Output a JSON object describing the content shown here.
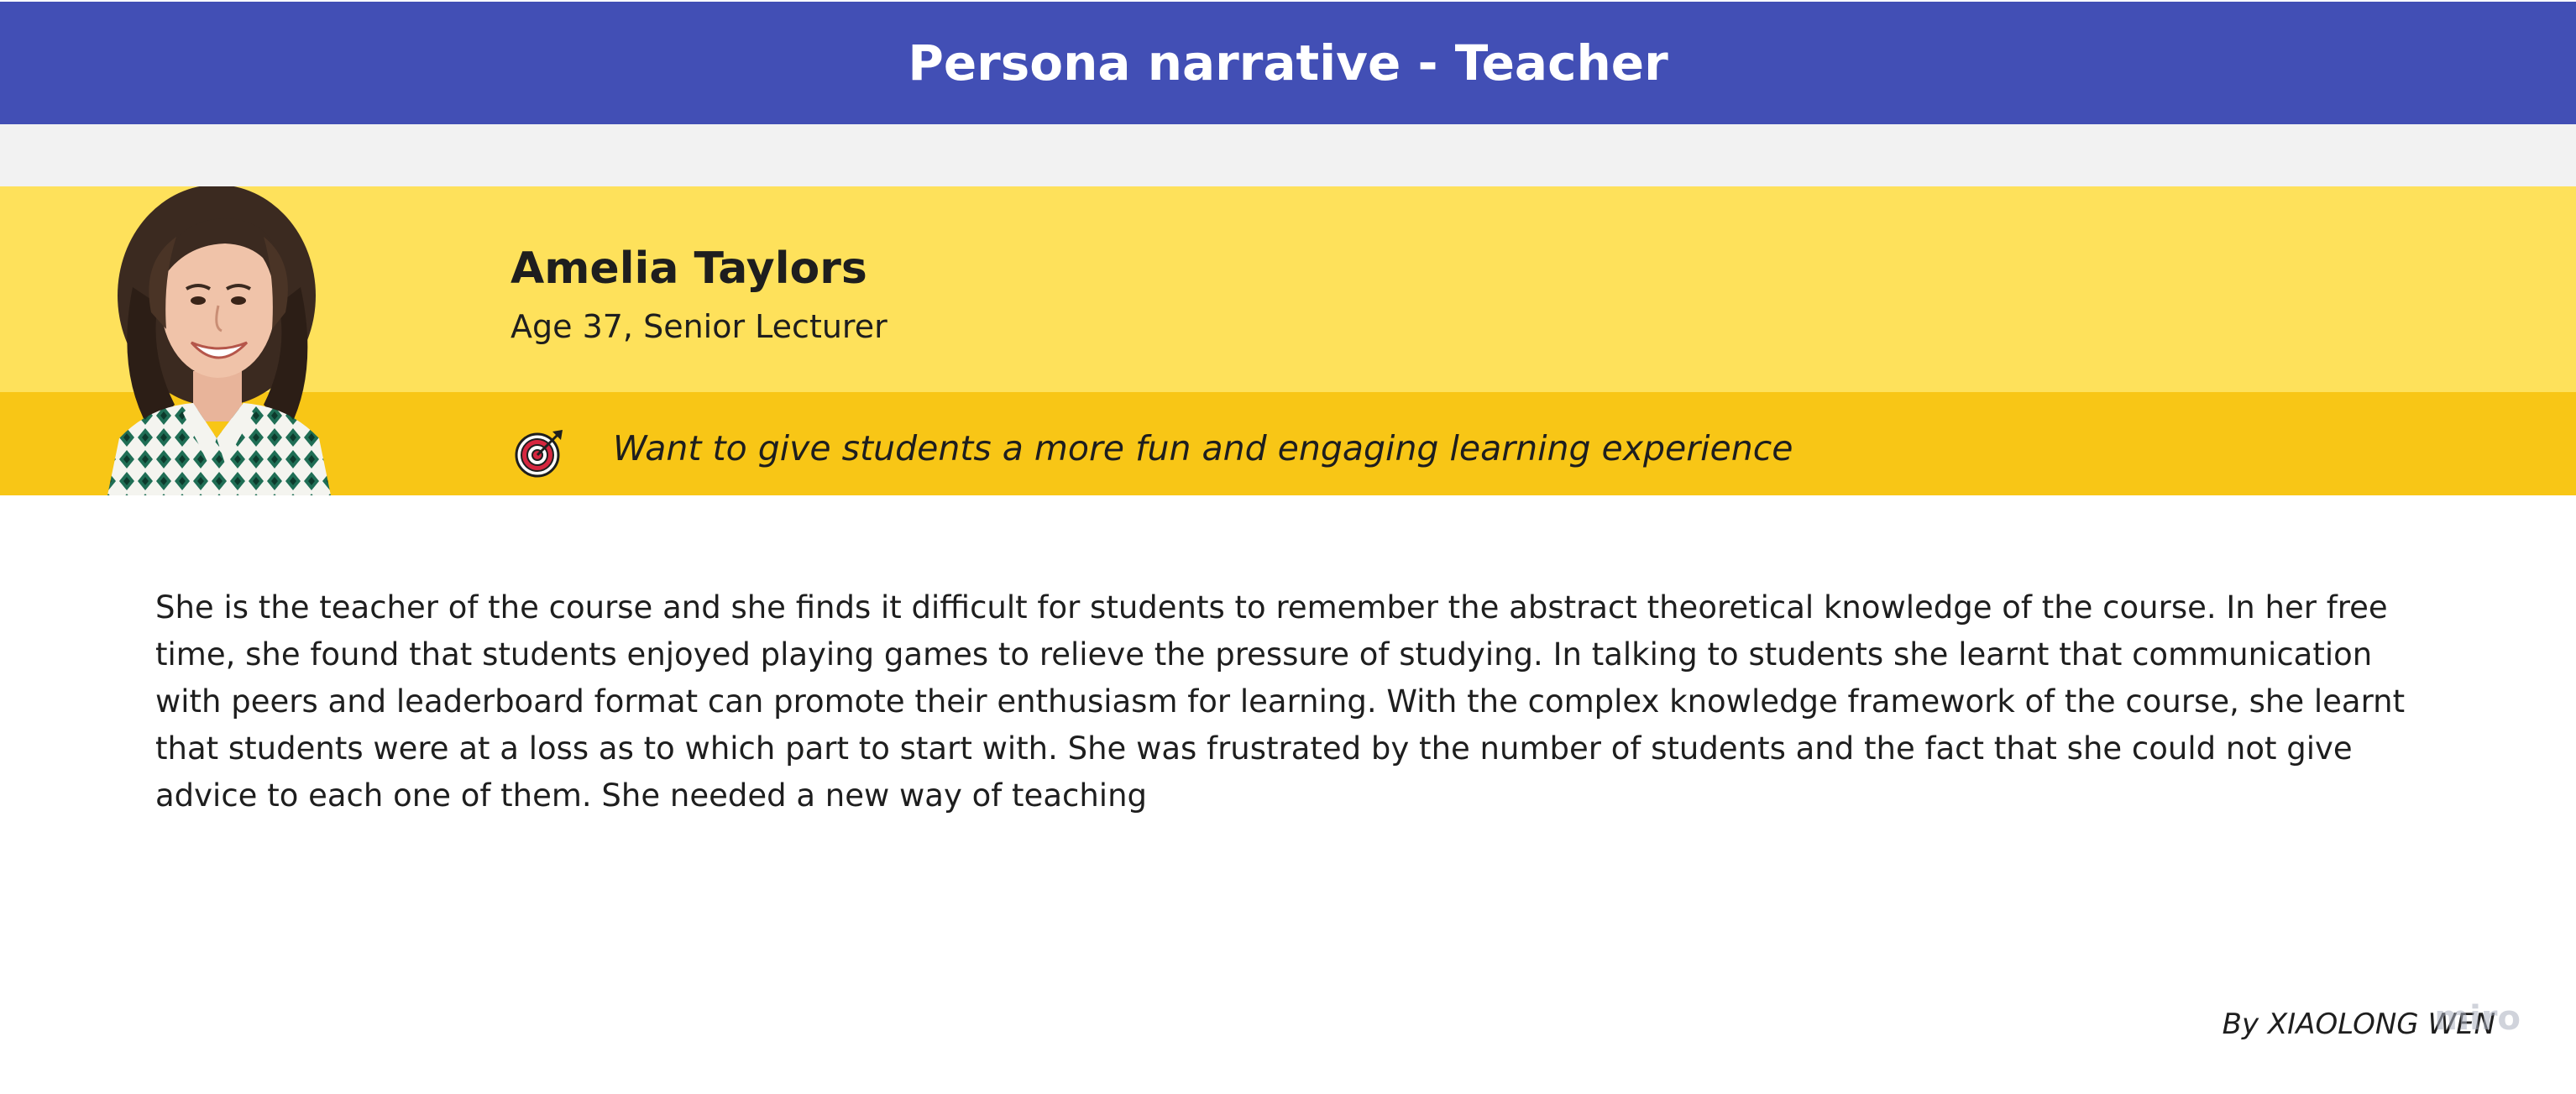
{
  "header": {
    "title": "Persona narrative - Teacher"
  },
  "persona": {
    "name": "Amelia Taylors",
    "role": "Age 37, Senior Lecturer",
    "goal": "Want to give students a more fun and engaging learning experience",
    "goal_icon": "target-icon"
  },
  "narrative": {
    "text": "She is the teacher of the course and she finds it difficult for students to remember the abstract theoretical knowledge of the course. In her free time, she found that students enjoyed playing games to relieve the pressure of studying. In talking to students she learnt that communication with peers and leaderboard format can promote their enthusiasm for learning. With the complex knowledge framework of the course, she learnt that students were at a loss as to which part to start with. She was frustrated by the number of students and the fact that she could not give advice to each one of them. She needed a new way of teaching"
  },
  "footer": {
    "author": "By XIAOLONG WEN",
    "watermark": "miro"
  },
  "colors": {
    "header_bg": "#424fb5",
    "band_gray": "#f2f2f2",
    "band_yellow": "#fee15b",
    "band_gold": "#f8c616"
  }
}
